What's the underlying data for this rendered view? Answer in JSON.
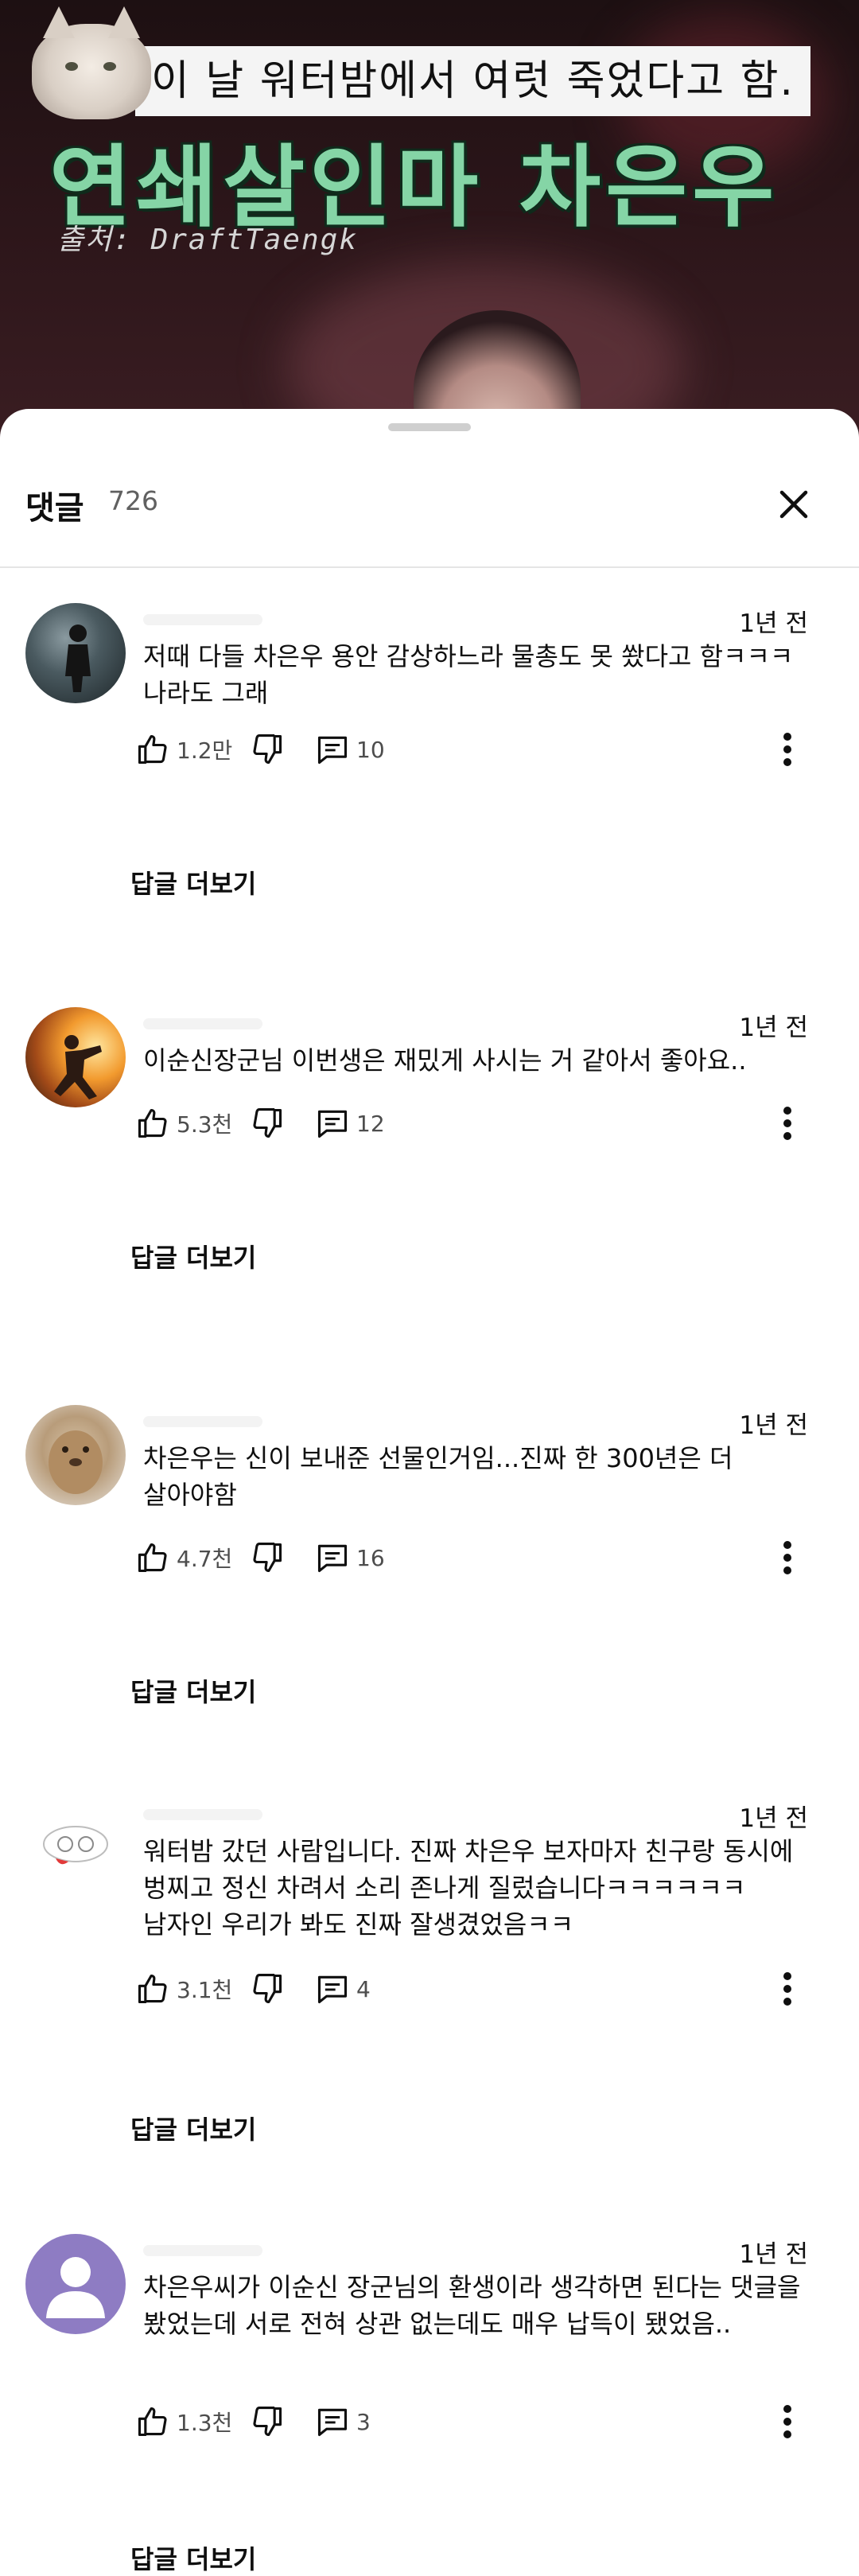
{
  "video": {
    "caption": "이 날 워터밤에서 여럿 죽었다고 함.",
    "title": "연쇄살인마 차은우",
    "source": "출처: DraftTaengk"
  },
  "comments_sheet": {
    "title": "댓글",
    "count": "726"
  },
  "comments": [
    {
      "time": "1년 전",
      "text": "저때 다들 차은우 용안 감상하느라 물총도 못 쐈다고 함ㅋㅋㅋ 나라도 그래",
      "likes": "1.2만",
      "replies": "10",
      "more_replies_label": "답글 더보기"
    },
    {
      "time": "1년 전",
      "text": "이순신장군님 이번생은 재밌게 사시는 거 같아서 좋아요..",
      "likes": "5.3천",
      "replies": "12",
      "more_replies_label": "답글 더보기"
    },
    {
      "time": "1년 전",
      "text": "차은우는 신이 보내준 선물인거임...진짜 한 300년은 더 살아야함",
      "likes": "4.7천",
      "replies": "16",
      "more_replies_label": "답글 더보기"
    },
    {
      "time": "1년 전",
      "text": "워터밤 갔던 사람입니다. 진짜 차은우 보자마자 친구랑 동시에 벙찌고 정신 차려서 소리 존나게 질렀습니다ㅋㅋㅋㅋㅋㅋ 남자인 우리가 봐도 진짜 잘생겼었음ㅋㅋ",
      "likes": "3.1천",
      "replies": "4",
      "more_replies_label": "답글 더보기"
    },
    {
      "time": "1년 전",
      "text": "차은우씨가 이순신 장군님의 환생이라 생각하면 된다는 댓글을 봤었는데 서로 전혀 상관 없는데도 매우 납득이 됐었음..",
      "likes": "1.3천",
      "replies": "3",
      "more_replies_label": "답글 더보기"
    }
  ],
  "icons": {
    "close": "close-icon",
    "like": "thumbs-up-icon",
    "dislike": "thumbs-down-icon",
    "reply": "comment-icon",
    "more": "more-vert-icon"
  },
  "colors": {
    "title_green": "#85d5a6",
    "text_primary": "#0f0f0f",
    "text_secondary": "#606060",
    "default_avatar": "#8e7cc3"
  }
}
